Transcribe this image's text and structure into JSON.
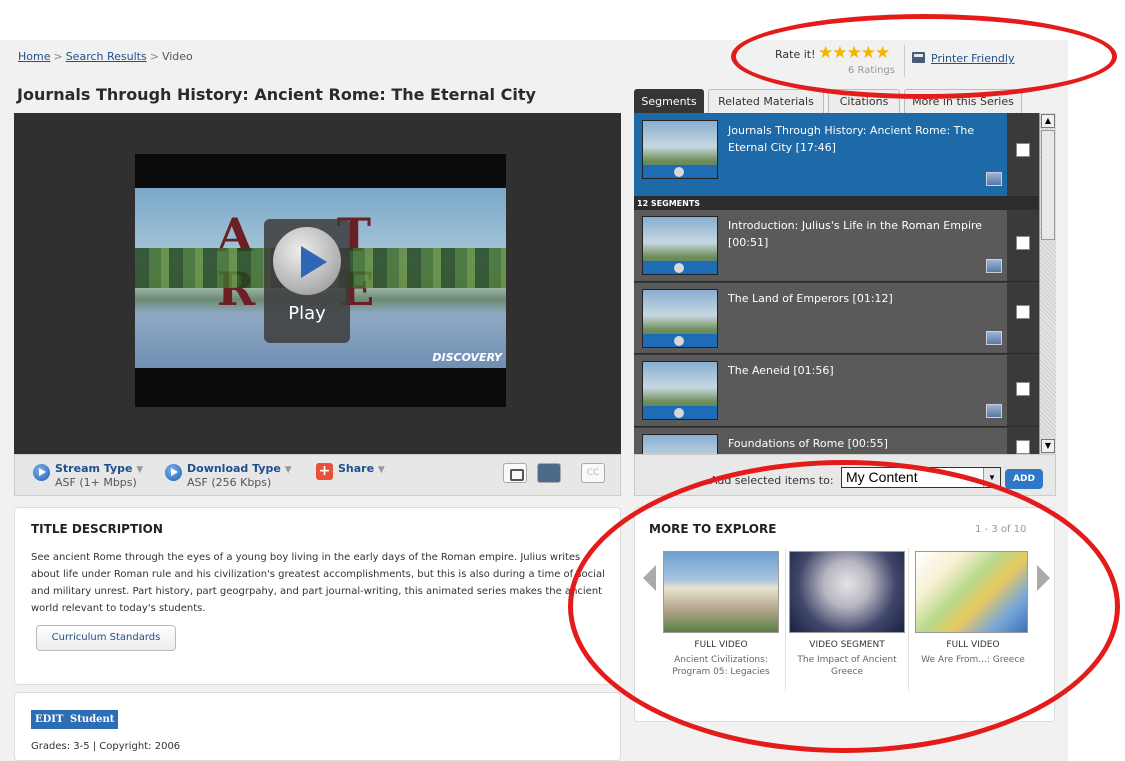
{
  "breadcrumb": {
    "home": "Home",
    "search": "Search Results",
    "current": "Video",
    "sep": ">"
  },
  "title": "Journals Through History: Ancient Rome: The Eternal City",
  "rating": {
    "label": "Rate it!",
    "stars": "★★★★★",
    "count": "6 Ratings",
    "value": 5,
    "max": 5,
    "star_color": "#f3b400"
  },
  "printer": {
    "label": "Printer Friendly",
    "icon": "printer-icon"
  },
  "player": {
    "play_label": "Play",
    "video_title_text": "A    T R     E",
    "watermark": "DISCOVERY"
  },
  "controls": {
    "stream": {
      "label": "Stream Type",
      "caret": "▼",
      "value": "ASF (1+ Mbps)"
    },
    "download": {
      "label": "Download Type",
      "caret": "▼",
      "value": "ASF (256 Kbps)"
    },
    "share": {
      "label": "Share",
      "caret": "▼",
      "icon": "+"
    },
    "cc": "CC"
  },
  "tabs": [
    "Segments",
    "Related Materials",
    "Citations",
    "More in this Series"
  ],
  "segments": {
    "full": {
      "title": "Journals Through History: Ancient Rome: The Eternal City [17:46]"
    },
    "count_label": "12 SEGMENTS",
    "items": [
      {
        "title": "Introduction: Julius's Life in the Roman Empire [00:51]"
      },
      {
        "title": "The Land of Emperors [01:12]"
      },
      {
        "title": "The Aeneid [01:56]"
      },
      {
        "title": "Foundations of Rome [00:55]"
      }
    ]
  },
  "add_bar": {
    "label": "Add selected items to:",
    "select_value": "My Content",
    "button": "ADD"
  },
  "description": {
    "heading": "TITLE DESCRIPTION",
    "text": "See ancient Rome through the eyes of a young boy living in the early days of the Roman empire. Julius writes about life under Roman rule and his civilization's greatest accomplishments, but this is also during a time of social and military unrest. Part history, part geogrpahy, and part journal-writing, this animated series makes the ancient world relevant to today's students.",
    "curriculum_button": "Curriculum Standards"
  },
  "meta": {
    "edit_tag": "EDIT",
    "student_tag": "Student",
    "grades": "Grades: 3-5  |  Copyright: 2006"
  },
  "explore": {
    "heading": "MORE TO EXPLORE",
    "count": "1 - 3 of 10",
    "items": [
      {
        "type": "FULL VIDEO",
        "name": "Ancient Civilizations: Program 05: Legacies"
      },
      {
        "type": "VIDEO SEGMENT",
        "name": "The Impact of Ancient Greece"
      },
      {
        "type": "FULL VIDEO",
        "name": "We Are From...: Greece"
      }
    ]
  },
  "colors": {
    "link": "#23518c",
    "accent_blue": "#1e6aa8",
    "highlight_oval": "#e41b1b"
  }
}
